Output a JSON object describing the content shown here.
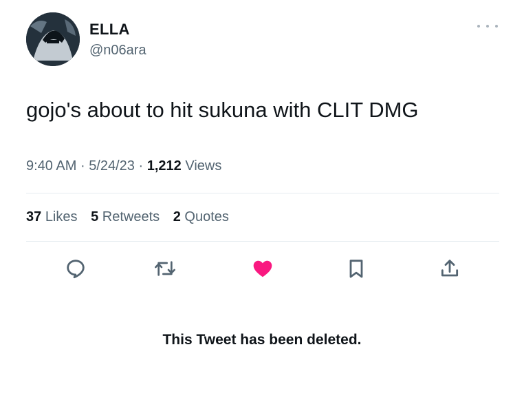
{
  "user": {
    "display_name": "ELLA",
    "handle": "@n06ara"
  },
  "tweet": {
    "text": "gojo's about to hit sukuna with CLIT DMG",
    "time": "9:40 AM",
    "separator": "·",
    "date": "5/24/23",
    "views_count": "1,212",
    "views_label": "Views"
  },
  "stats": {
    "likes_count": "37",
    "likes_label": "Likes",
    "retweets_count": "5",
    "retweets_label": "Retweets",
    "quotes_count": "2",
    "quotes_label": "Quotes"
  },
  "actions": {
    "reply_icon": "reply-icon",
    "retweet_icon": "retweet-icon",
    "like_icon": "heart-icon",
    "bookmark_icon": "bookmark-icon",
    "share_icon": "share-icon",
    "like_active": true,
    "like_color": "#f91880",
    "icon_color": "#536471"
  },
  "notice": "This Tweet has been deleted."
}
